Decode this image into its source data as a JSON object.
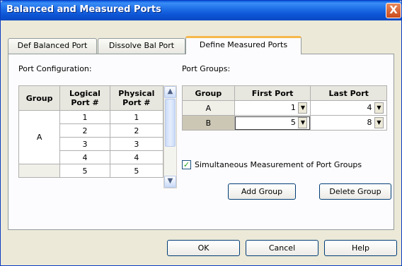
{
  "window": {
    "title": "Balanced and Measured Ports",
    "close_glyph": "X"
  },
  "tabs": [
    {
      "label": "Def Balanced Port",
      "active": false
    },
    {
      "label": "Dissolve Bal Port",
      "active": false
    },
    {
      "label": "Define Measured Ports",
      "active": true
    }
  ],
  "port_config": {
    "label": "Port Configuration:",
    "headers": {
      "group": "Group",
      "logical": "Logical\nPort #",
      "physical": "Physical\nPort #"
    },
    "group_a": "A",
    "rows": [
      {
        "logical": "1",
        "physical": "1"
      },
      {
        "logical": "2",
        "physical": "2"
      },
      {
        "logical": "3",
        "physical": "3"
      },
      {
        "logical": "4",
        "physical": "4"
      },
      {
        "logical": "5",
        "physical": "5"
      }
    ]
  },
  "port_groups": {
    "label": "Port Groups:",
    "headers": {
      "group": "Group",
      "first": "First Port",
      "last": "Last Port"
    },
    "rows": [
      {
        "group": "A",
        "first": "1",
        "last": "4"
      },
      {
        "group": "B",
        "first": "5",
        "last": "8"
      }
    ]
  },
  "simultaneous": {
    "label": "Simultaneous Measurement of Port Groups",
    "checked": true
  },
  "buttons": {
    "add_group": "Add Group",
    "delete_group": "Delete Group",
    "ok": "OK",
    "cancel": "Cancel",
    "help": "Help"
  },
  "colors": {
    "title_bar": "#0a5be0",
    "tab_active_accent": "#f6b84a",
    "selected_row": "#ccc7b5"
  }
}
